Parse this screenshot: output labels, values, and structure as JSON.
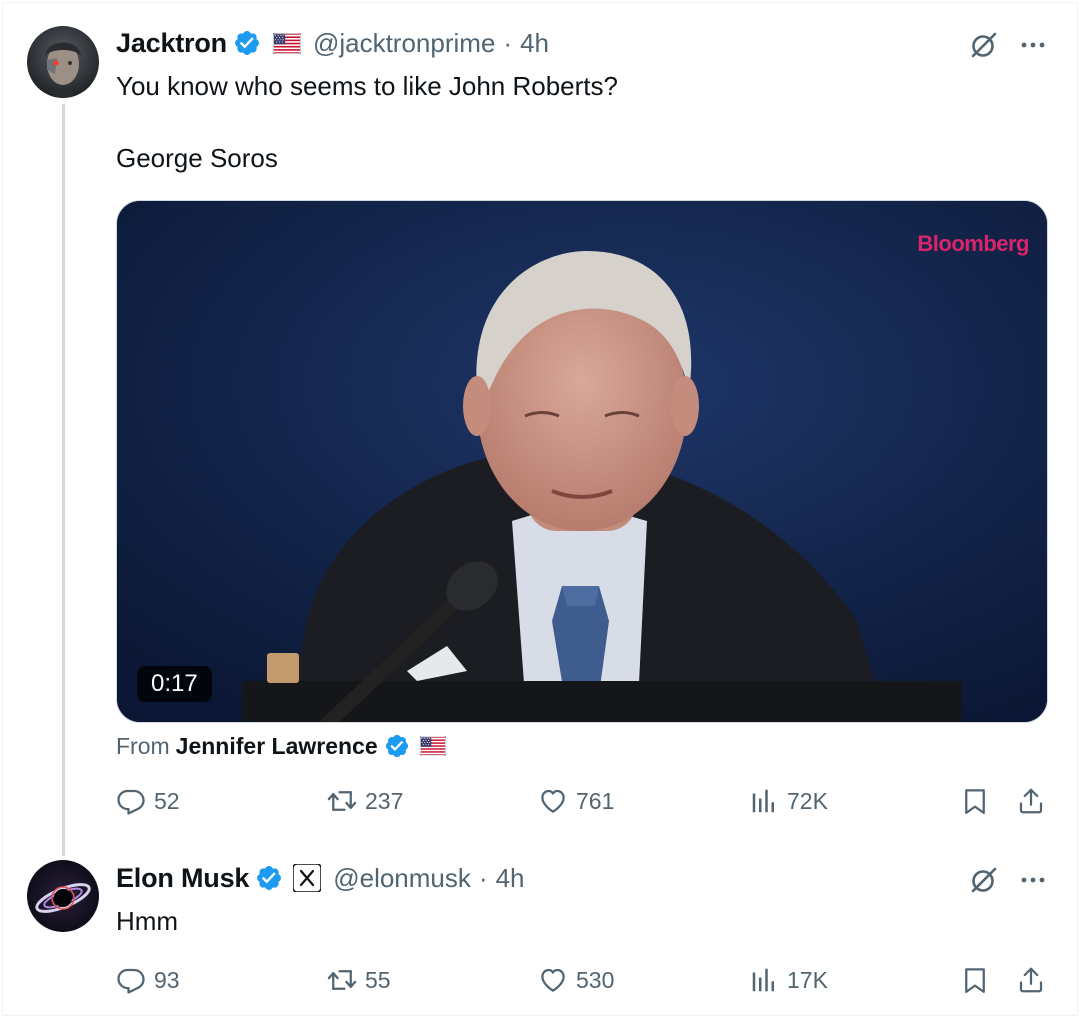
{
  "tweets": [
    {
      "author_name": "Jacktron",
      "handle": "@jacktronprime",
      "separator": "·",
      "time": "4h",
      "text_line1": "You know who seems to like John Roberts?",
      "text_line2": "George Soros",
      "media": {
        "watermark": "Bloomberg",
        "duration": "0:17",
        "from_label": "From",
        "from_name": "Jennifer Lawrence"
      },
      "stats": {
        "replies": "52",
        "reposts": "237",
        "likes": "761",
        "views": "72K"
      }
    },
    {
      "author_name": "Elon Musk",
      "handle": "@elonmusk",
      "separator": "·",
      "time": "4h",
      "text_line1": "Hmm",
      "stats": {
        "replies": "93",
        "reposts": "55",
        "likes": "530",
        "views": "17K"
      }
    }
  ],
  "colors": {
    "verified": "#1d9bf0",
    "secondary_text": "#536471",
    "primary_text": "#0f1419",
    "watermark": "#d9246d"
  },
  "icons": {
    "verified": "verified-badge-icon",
    "flag": "us-flag-icon",
    "x_logo": "x-logo-icon",
    "grok": "grok-icon",
    "more": "more-icon",
    "reply": "reply-icon",
    "repost": "repost-icon",
    "like": "like-icon",
    "views": "views-icon",
    "bookmark": "bookmark-icon",
    "share": "share-icon"
  }
}
